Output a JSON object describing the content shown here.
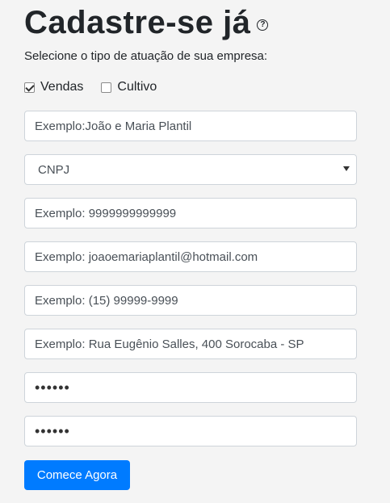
{
  "header": {
    "title": "Cadastre-se já",
    "help_icon_glyph": "?"
  },
  "subtitle": "Selecione o tipo de atuação de sua empresa:",
  "business_types": [
    {
      "label": "Vendas",
      "checked": true
    },
    {
      "label": "Cultivo",
      "checked": false
    }
  ],
  "form": {
    "name_placeholder": "Exemplo:João e Maria Plantil",
    "doc_type_selected": "CNPJ",
    "doc_number_placeholder": "Exemplo: 9999999999999",
    "email_placeholder": "Exemplo: joaoemariaplantil@hotmail.com",
    "phone_placeholder": "Exemplo: (15) 99999-9999",
    "address_placeholder": "Exemplo: Rua Eugênio Salles, 400 Sorocaba - SP",
    "password_masked": "••••••",
    "password_confirm_masked": "••••••"
  },
  "submit_label": "Comece Agora",
  "colors": {
    "primary": "#007bff",
    "background": "#f4f4f4"
  }
}
